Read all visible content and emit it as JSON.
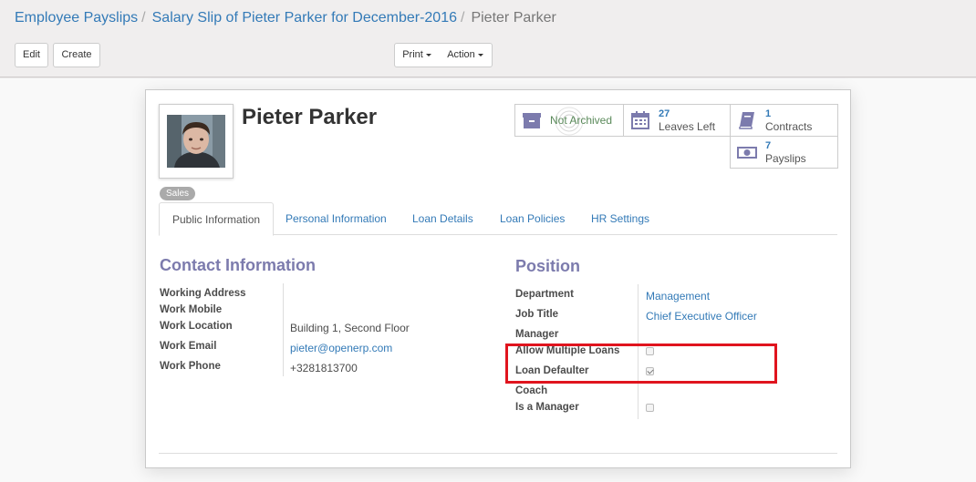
{
  "breadcrumb": {
    "items": [
      "Employee Payslips",
      "Salary Slip of Pieter Parker for December-2016"
    ],
    "active": "Pieter Parker"
  },
  "buttons": {
    "edit": "Edit",
    "create": "Create",
    "print": "Print",
    "action": "Action"
  },
  "employee": {
    "name": "Pieter Parker",
    "tag": "Sales"
  },
  "stats": {
    "archive": "Not Archived",
    "leaves": {
      "count": "27",
      "label": "Leaves Left"
    },
    "contracts": {
      "count": "1",
      "label": "Contracts"
    },
    "payslips": {
      "count": "7",
      "label": "Payslips"
    }
  },
  "tabs": [
    "Public Information",
    "Personal Information",
    "Loan Details",
    "Loan Policies",
    "HR Settings"
  ],
  "contact": {
    "title": "Contact Information",
    "fields": [
      {
        "label": "Working Address",
        "value": ""
      },
      {
        "label": "Work Mobile",
        "value": ""
      },
      {
        "label": "Work Location",
        "value": "Building 1, Second Floor"
      },
      {
        "label": "Work Email",
        "value": "pieter@openerp.com"
      },
      {
        "label": "Work Phone",
        "value": "+3281813700"
      }
    ]
  },
  "position": {
    "title": "Position",
    "fields": [
      {
        "label": "Department",
        "value": "Management"
      },
      {
        "label": "Job Title",
        "value": "Chief Executive Officer"
      },
      {
        "label": "Manager",
        "value": ""
      },
      {
        "label": "Allow Multiple Loans",
        "checked": false
      },
      {
        "label": "Loan Defaulter",
        "checked": true
      },
      {
        "label": "Coach",
        "value": ""
      },
      {
        "label": "Is a Manager",
        "checked": false
      }
    ]
  }
}
